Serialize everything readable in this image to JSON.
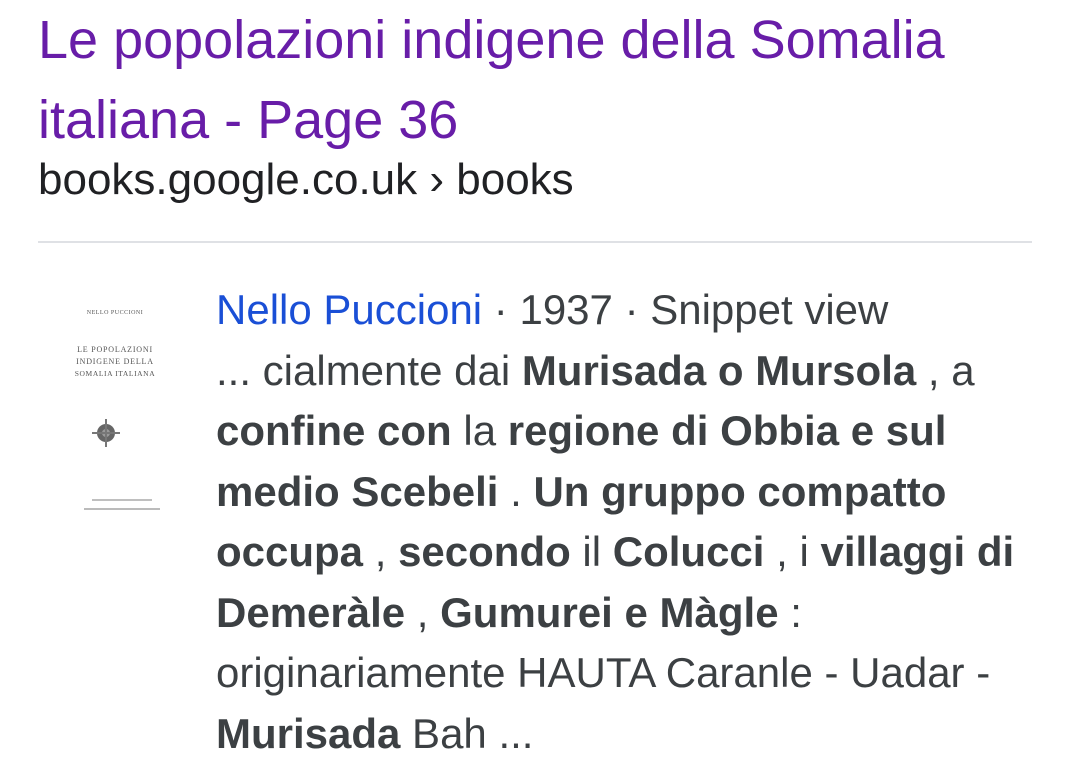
{
  "result": {
    "title": "Le popolazioni indigene della Somalia italiana - Page 36",
    "url": "books.google.co.uk › books"
  },
  "book": {
    "author": "Nello Puccioni",
    "meta": " · 1937 · Snippet view",
    "thumbnail": {
      "header": "NELLO PUCCIONI",
      "title_lines": [
        "LE POPOLAZIONI",
        "INDIGENE DELLA",
        "SOMALIA ITALIANA"
      ]
    }
  },
  "snippet": {
    "segments": [
      {
        "text": "... cialmente dai ",
        "bold": false
      },
      {
        "text": "Murisada o Mursola",
        "bold": true
      },
      {
        "text": " , a ",
        "bold": false
      },
      {
        "text": "confine con",
        "bold": true
      },
      {
        "text": " la ",
        "bold": false
      },
      {
        "text": "regione di Obbia e sul medio Scebeli",
        "bold": true
      },
      {
        "text": " . ",
        "bold": false
      },
      {
        "text": "Un gruppo compatto occupa",
        "bold": true
      },
      {
        "text": " , ",
        "bold": false
      },
      {
        "text": "secondo",
        "bold": true
      },
      {
        "text": " il ",
        "bold": false
      },
      {
        "text": "Colucci",
        "bold": true
      },
      {
        "text": " , i ",
        "bold": false
      },
      {
        "text": "villaggi di Demeràle",
        "bold": true
      },
      {
        "text": " , ",
        "bold": false
      },
      {
        "text": "Gumurei e Màgle",
        "bold": true
      },
      {
        "text": " : originariamente HAUTA Caranle - Uadar - ",
        "bold": false
      },
      {
        "text": "Murisada",
        "bold": true
      },
      {
        "text": " Bah ...",
        "bold": false
      }
    ]
  }
}
